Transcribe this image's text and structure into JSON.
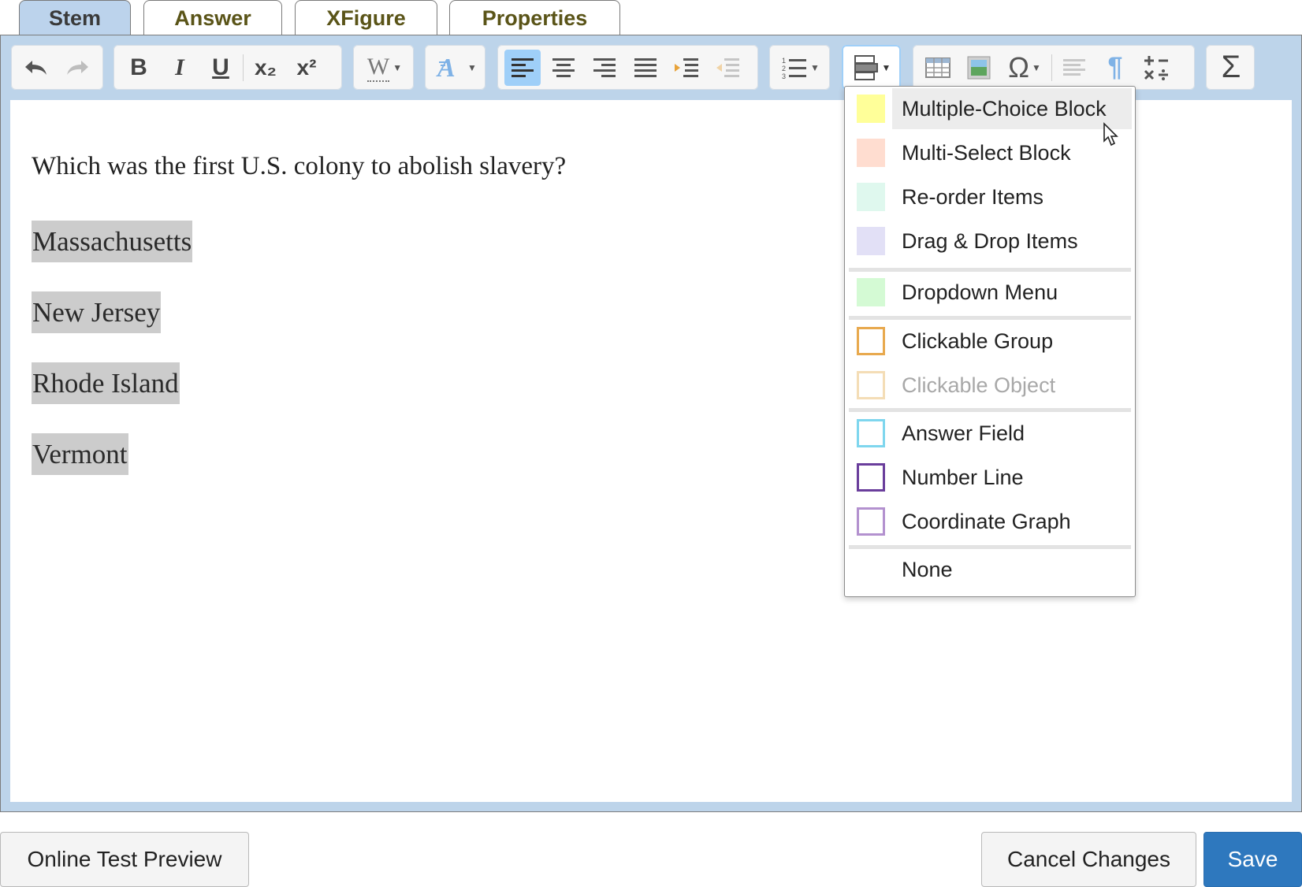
{
  "tabs": [
    {
      "label": "Stem",
      "active": true
    },
    {
      "label": "Answer",
      "active": false
    },
    {
      "label": "XFigure",
      "active": false
    },
    {
      "label": "Properties",
      "active": false
    }
  ],
  "toolbar": {
    "undo_icon": "undo-icon",
    "redo_icon": "redo-icon",
    "bold_icon": "B",
    "italic_icon": "I",
    "underline_icon": "U",
    "subscript_icon": "x₂",
    "superscript_icon": "x²",
    "word_icon": "W",
    "omega_icon": "Ω",
    "sigma_icon": "Σ",
    "pilcrow_icon": "¶"
  },
  "editor": {
    "question": "Which was the first U.S. colony to abolish slavery?",
    "choices": [
      "Massachusetts",
      "New Jersey",
      "Rhode Island",
      "Vermont"
    ]
  },
  "dropdown": {
    "items": [
      {
        "label": "Multiple-Choice Block",
        "swatch": "#ffff99",
        "style": "fill",
        "highlighted": true
      },
      {
        "label": "Multi-Select Block",
        "swatch": "#ffddd0",
        "style": "fill"
      },
      {
        "label": "Re-order Items",
        "swatch": "#dff8ee",
        "style": "fill"
      },
      {
        "label": "Drag & Drop Items",
        "swatch": "#e2e0f6",
        "style": "fill"
      },
      {
        "label": "Dropdown Menu",
        "swatch": "#d4fad4",
        "style": "fill"
      },
      {
        "label": "Clickable Group",
        "swatch": "#e8a94e",
        "style": "outline"
      },
      {
        "label": "Clickable Object",
        "swatch": "#f4ddb6",
        "style": "outline",
        "disabled": true
      },
      {
        "label": "Answer Field",
        "swatch": "#7ed6ee",
        "style": "outline"
      },
      {
        "label": "Number Line",
        "swatch": "#6a3e9c",
        "style": "outline"
      },
      {
        "label": "Coordinate Graph",
        "swatch": "#b391cf",
        "style": "outline"
      },
      {
        "label": "None",
        "swatch": "",
        "style": "none"
      }
    ]
  },
  "buttons": {
    "preview": "Online Test Preview",
    "cancel": "Cancel Changes",
    "save": "Save"
  },
  "colors": {
    "accent": "#2e78be",
    "tab_active": "#bcd3ec",
    "editor_frame": "#bdd4ea",
    "tab_text": "#5a5418",
    "toolbar_active": "#9fcff8"
  }
}
